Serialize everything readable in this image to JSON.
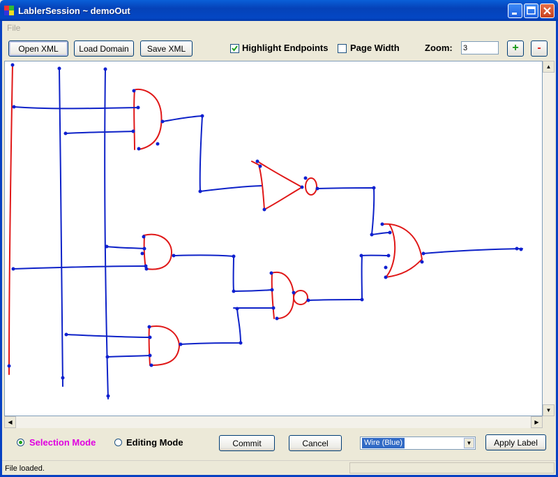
{
  "window": {
    "title": "LablerSession ~ demoOut"
  },
  "menu": {
    "file": "File"
  },
  "toolbar": {
    "open_xml": "Open XML",
    "load_domain": "Load Domain",
    "save_xml": "Save XML",
    "highlight_endpoints": {
      "label": "Highlight Endpoints",
      "checked": true
    },
    "page_width": {
      "label": "Page Width",
      "checked": false
    },
    "zoom_label": "Zoom:",
    "zoom_value": "3",
    "zoom_in": "+",
    "zoom_out": "-"
  },
  "colors": {
    "wire": "#0e22c8",
    "gate": "#e01818",
    "endpoint": "#1020d0",
    "selection_mode": "#e000e0"
  },
  "modes": {
    "selection": "Selection Mode",
    "editing": "Editing Mode",
    "selected": "selection"
  },
  "actions": {
    "commit": "Commit",
    "cancel": "Cancel",
    "apply_label": "Apply Label"
  },
  "label_select": {
    "value": "Wire   (Blue)"
  },
  "status": {
    "text": "File loaded."
  }
}
